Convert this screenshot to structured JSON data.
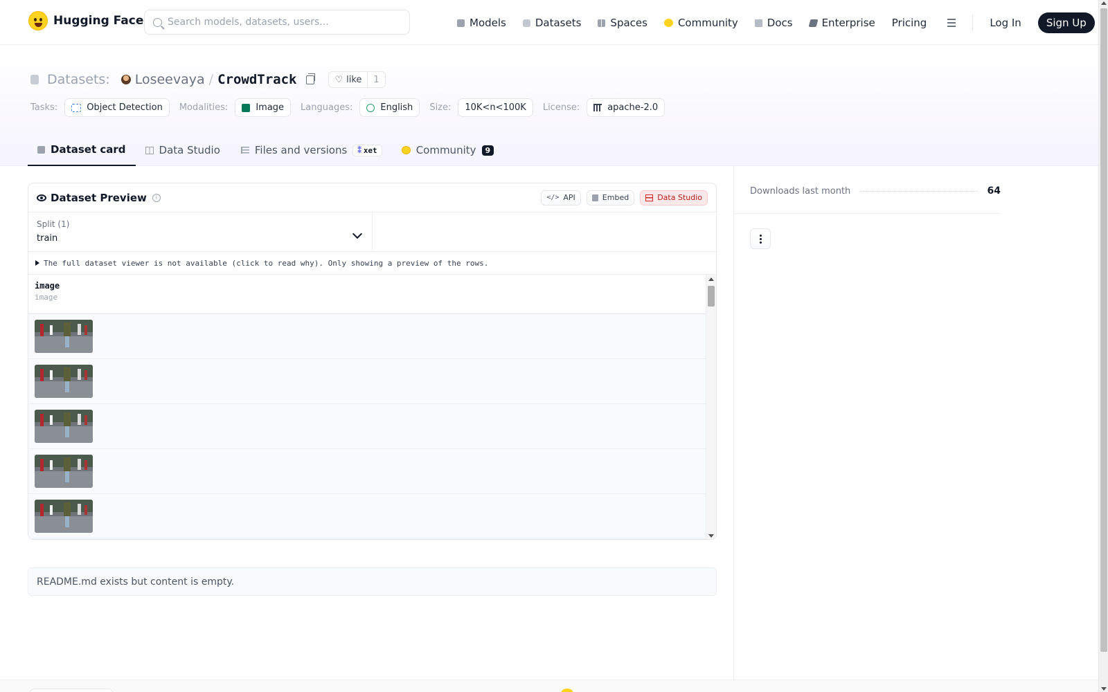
{
  "nav": {
    "brand": "Hugging Face",
    "search_placeholder": "Search models, datasets, users...",
    "links": [
      {
        "label": "Models",
        "icon": "cube-icon"
      },
      {
        "label": "Datasets",
        "icon": "database-icon"
      },
      {
        "label": "Spaces",
        "icon": "spaces-icon"
      },
      {
        "label": "Community",
        "icon": "hug-icon"
      },
      {
        "label": "Docs",
        "icon": "book-icon"
      },
      {
        "label": "Enterprise",
        "icon": "enterprise-icon"
      },
      {
        "label": "Pricing"
      }
    ],
    "login": "Log In",
    "signup": "Sign Up"
  },
  "repo": {
    "kind": "Datasets:",
    "owner": "Loseevaya",
    "separator": "/",
    "name": "CrowdTrack",
    "like_label": "like",
    "like_count": "1"
  },
  "tags": {
    "tasks_label": "Tasks:",
    "task": "Object Detection",
    "modalities_label": "Modalities:",
    "modality": "Image",
    "languages_label": "Languages:",
    "language": "English",
    "size_label": "Size:",
    "size": "10K<n<100K",
    "license_label": "License:",
    "license": "apache-2.0"
  },
  "tabs": [
    {
      "label": "Dataset card",
      "active": true
    },
    {
      "label": "Data Studio"
    },
    {
      "label": "Files and versions",
      "badge": "xet"
    },
    {
      "label": "Community",
      "count": "9"
    }
  ],
  "preview": {
    "title": "Dataset Preview",
    "api_label": "API",
    "embed_label": "Embed",
    "studio_label": "Data Studio",
    "split_label": "Split (1)",
    "split_value": "train",
    "notice": "The full dataset viewer is not available (click to read why). Only showing a preview of the rows.",
    "column_name": "image",
    "column_type": "image",
    "row_count_visible": 5
  },
  "readme": "README.md exists but content is empty.",
  "sidebar": {
    "downloads_label": "Downloads last month",
    "downloads_value": "64"
  },
  "colors": {
    "brand_yellow": "#FFD21E",
    "text_dark": "#111827",
    "studio_red": "#dc2626"
  }
}
